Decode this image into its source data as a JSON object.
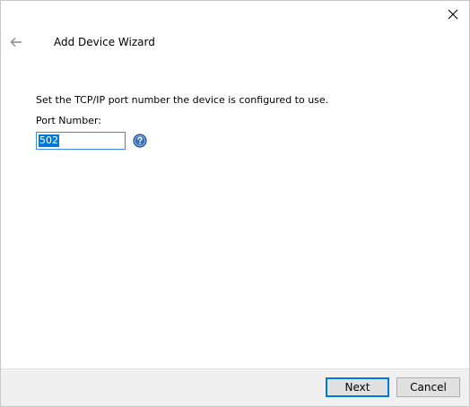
{
  "window": {
    "title": "Add Device Wizard"
  },
  "icons": {
    "close": "close-icon",
    "back": "arrow-left-icon",
    "help": "help-icon"
  },
  "content": {
    "instruction": "Set the TCP/IP port number the device is configured to use.",
    "port_label": "Port Number:",
    "port_value": "502"
  },
  "footer": {
    "next_label": "Next",
    "cancel_label": "Cancel"
  },
  "colors": {
    "accent": "#0078d7",
    "footer_bg": "#f0f0f0",
    "button_bg": "#e1e1e1",
    "help_icon": "#3b6fb6"
  }
}
